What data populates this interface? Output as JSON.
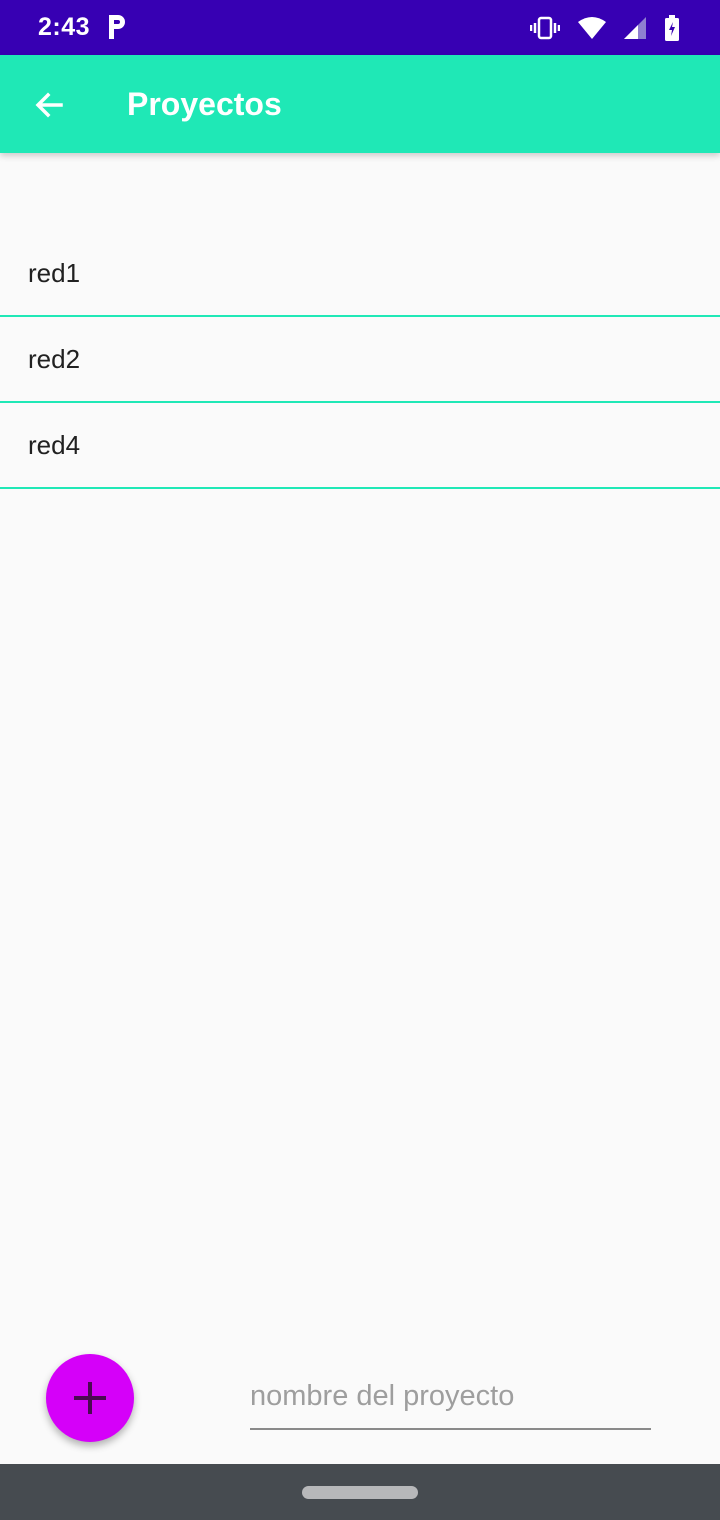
{
  "status_bar": {
    "time": "2:43",
    "icons": [
      "parking-notification-icon",
      "vibrate-icon",
      "wifi-icon",
      "cell-signal-icon",
      "battery-charging-icon"
    ]
  },
  "app_bar": {
    "title": "Proyectos",
    "back_icon": "arrow-back-icon",
    "background_color": "#1fe8b6"
  },
  "projects": {
    "items": [
      "red1",
      "red2",
      "red4"
    ],
    "divider_color": "#1fe8b6"
  },
  "bottom": {
    "fab_icon": "plus-icon",
    "fab_color": "#d500f9",
    "name_input": {
      "placeholder": "nombre del proyecto",
      "value": ""
    }
  },
  "colors": {
    "status_bar": "#3700b3",
    "nav_bar": "#464b50"
  }
}
